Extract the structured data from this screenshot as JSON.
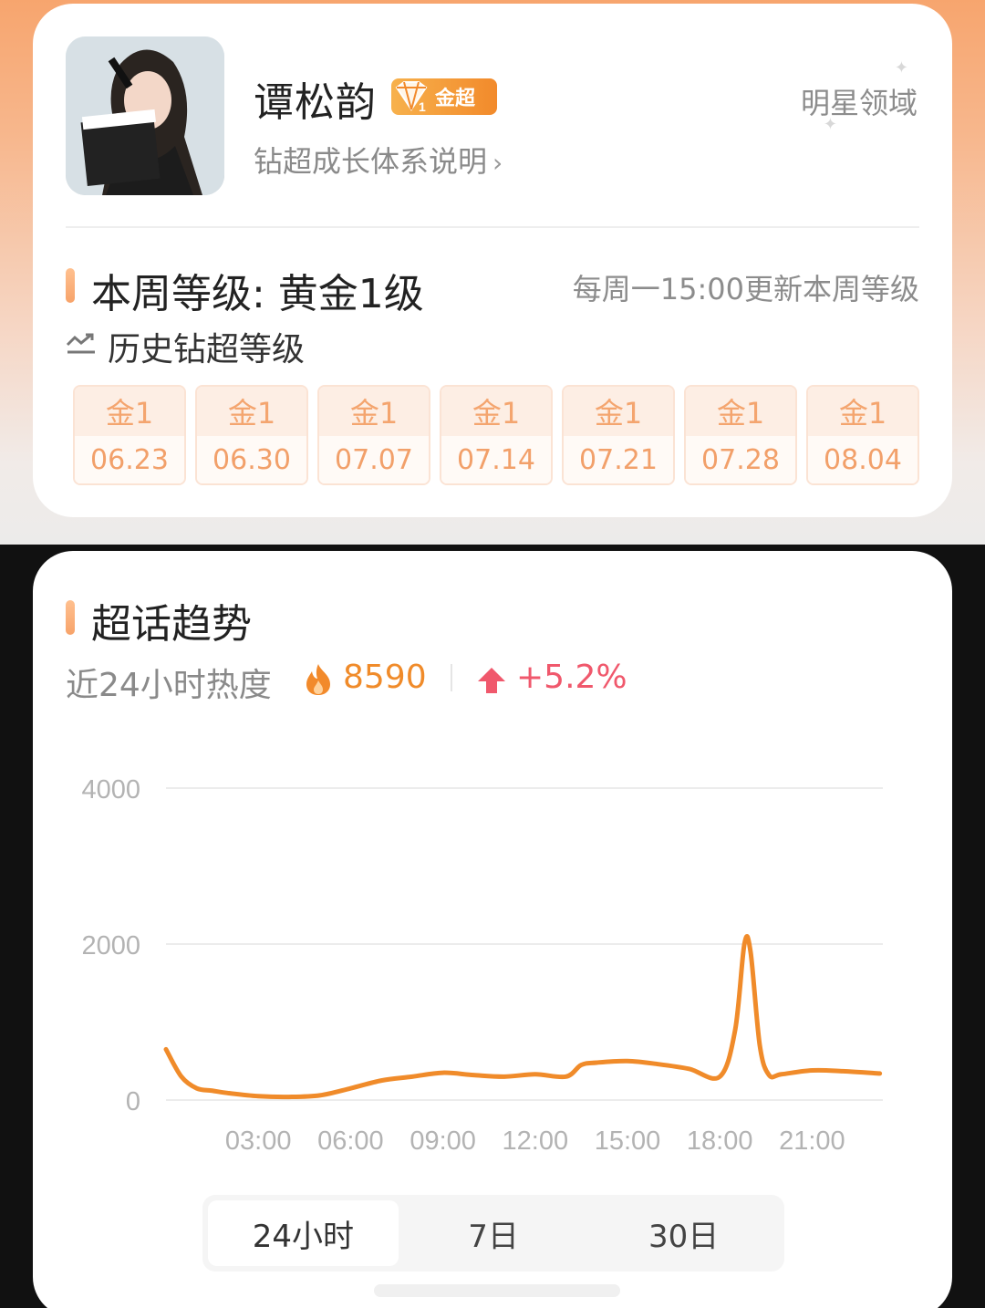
{
  "profile": {
    "name": "谭松韵",
    "badge_label": "金超",
    "badge_level": "1",
    "growth_link": "钻超成长体系说明",
    "domain": "明星领域"
  },
  "level": {
    "current": "本周等级: 黄金1级",
    "update_note": "每周一15:00更新本周等级",
    "history_title": "历史钻超等级",
    "history": [
      {
        "level": "金1",
        "date": "06.23"
      },
      {
        "level": "金1",
        "date": "06.30"
      },
      {
        "level": "金1",
        "date": "07.07"
      },
      {
        "level": "金1",
        "date": "07.14"
      },
      {
        "level": "金1",
        "date": "07.21"
      },
      {
        "level": "金1",
        "date": "07.28"
      },
      {
        "level": "金1",
        "date": "08.04"
      }
    ]
  },
  "trend": {
    "title": "超话趋势",
    "heat_label": "近24小时热度",
    "heat_value": "8590",
    "change": "+5.2%",
    "tabs": [
      "24小时",
      "7日",
      "30日"
    ],
    "active_tab": 0
  },
  "colors": {
    "accent": "#f08b2a",
    "up": "#f0586c",
    "line": "#f08b2a"
  },
  "chart_data": {
    "type": "line",
    "title": "",
    "xlabel": "",
    "ylabel": "",
    "ylim": [
      0,
      4000
    ],
    "xlim": [
      0,
      23.3
    ],
    "y_ticks": [
      "0",
      "2000",
      "4000"
    ],
    "x_ticks": [
      {
        "x": 3,
        "label": "03:00"
      },
      {
        "x": 6,
        "label": "06:00"
      },
      {
        "x": 9,
        "label": "09:00"
      },
      {
        "x": 12,
        "label": "12:00"
      },
      {
        "x": 15,
        "label": "15:00"
      },
      {
        "x": 18,
        "label": "18:00"
      },
      {
        "x": 21,
        "label": "21:00"
      }
    ],
    "grid": true,
    "series": [
      {
        "x": [
          0,
          0.5,
          1,
          1.5,
          2,
          3,
          4,
          5,
          6,
          7,
          8,
          9,
          10,
          11,
          12,
          13,
          13.5,
          14,
          15,
          16,
          17,
          18,
          18.5,
          18.8,
          19,
          19.3,
          19.6,
          20,
          21,
          22,
          23.2
        ],
        "values": [
          650,
          300,
          150,
          120,
          90,
          50,
          40,
          60,
          150,
          250,
          300,
          350,
          320,
          300,
          330,
          300,
          450,
          480,
          500,
          460,
          400,
          300,
          900,
          2000,
          1900,
          700,
          320,
          330,
          380,
          370,
          340
        ]
      }
    ]
  }
}
